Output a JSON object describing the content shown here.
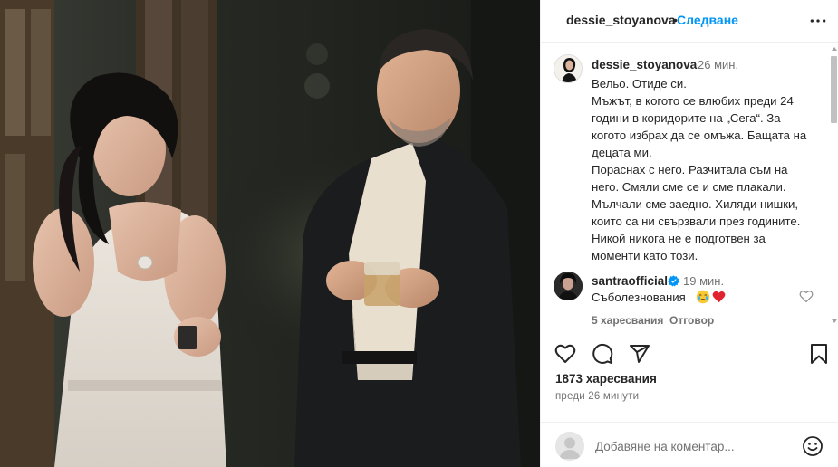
{
  "header": {
    "username": "dessie_stoyanova",
    "separator": "•",
    "follow_label": "Следване",
    "more_icon": "more-horizontal-icon"
  },
  "caption": {
    "username": "dessie_stoyanova",
    "time": "26 мин.",
    "text": "Вельо. Отиде си.\nМъжът, в когото се влюбих преди 24 години в коридорите на „Сега“. За когото избрах да се омъжа. Бащата на децата ми.\nПораснах с него. Разчитала съм на него. Смяли сме се и сме плакали. Мълчали сме заедно. Хиляди нишки, които са ни свързвали през годините. Никой никога не е подготвен за моменти като този."
  },
  "comment": {
    "username": "santraofficial",
    "verified_icon": "verified-badge-icon",
    "time": "19 мин.",
    "text": "Съболезнования",
    "emojis": [
      "crying-face-icon",
      "red-heart-icon"
    ],
    "likes_label": "5 харесвания",
    "reply_label": "Отговор"
  },
  "actions": {
    "icons": [
      "heart-icon",
      "comment-icon",
      "share-icon",
      "bookmark-icon"
    ]
  },
  "stats": {
    "likes": "1873 харесвания",
    "date": "преди 26 минути"
  },
  "add_comment": {
    "placeholder": "Добавяне на коментар...",
    "emoji_icon": "emoji-smiley-icon"
  },
  "colors": {
    "accent": "#0095f6",
    "text": "#262626",
    "muted": "#737373",
    "border": "#efefef",
    "heart_red": "#ed4956"
  }
}
